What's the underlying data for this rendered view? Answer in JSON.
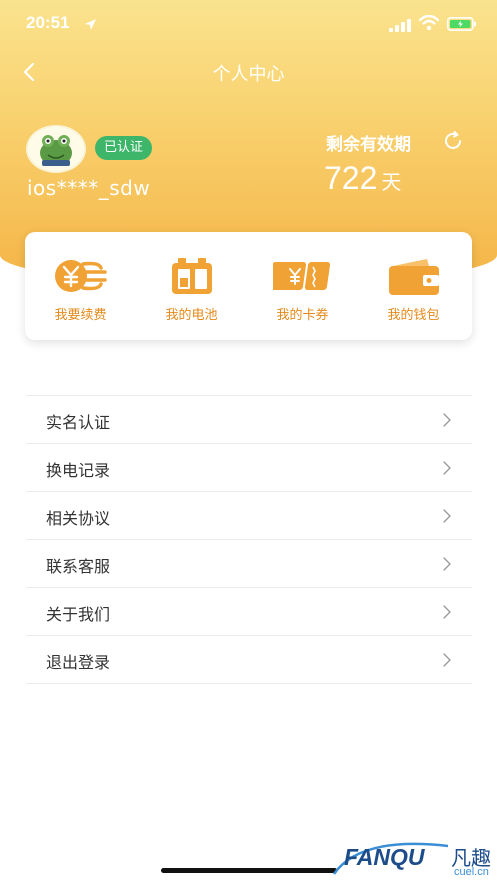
{
  "status_bar": {
    "time": "20:51"
  },
  "nav": {
    "title": "个人中心"
  },
  "profile": {
    "verified_label": "已认证",
    "username": "ios****_sdw",
    "validity_label": "剩余有效期",
    "validity_number": "722",
    "validity_unit": "天"
  },
  "shortcuts": [
    {
      "label": "我要续费",
      "icon": "renew-coin-icon"
    },
    {
      "label": "我的电池",
      "icon": "battery-icon"
    },
    {
      "label": "我的卡券",
      "icon": "coupon-icon"
    },
    {
      "label": "我的钱包",
      "icon": "wallet-icon"
    }
  ],
  "menu": [
    {
      "label": "实名认证"
    },
    {
      "label": "换电记录"
    },
    {
      "label": "相关协议"
    },
    {
      "label": "联系客服"
    },
    {
      "label": "关于我们"
    },
    {
      "label": "退出登录"
    }
  ],
  "watermark": {
    "brand": "FANQU",
    "brand_cn": "凡趣",
    "domain": "cuel.cn"
  },
  "colors": {
    "accent": "#e48a1b",
    "header_top": "#fae38e",
    "header_bottom": "#f4b446",
    "verified_green": "#3db66a"
  }
}
